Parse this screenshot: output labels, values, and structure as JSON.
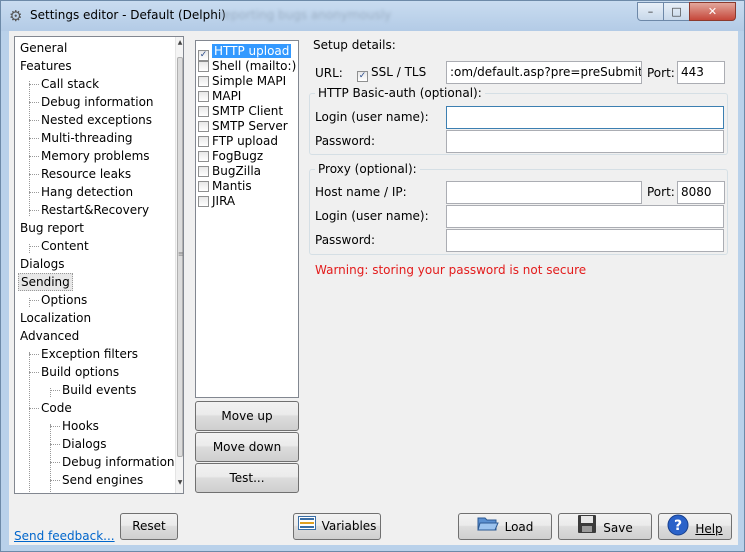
{
  "window": {
    "title": "Settings editor - Default (Delphi)",
    "title_ghost": "reporting bugs anonymously",
    "minimize": "–",
    "maximize": "□",
    "close": "✕"
  },
  "tree": {
    "items": [
      {
        "label": "General"
      },
      {
        "label": "Features"
      },
      {
        "label": "Call stack"
      },
      {
        "label": "Debug information"
      },
      {
        "label": "Nested exceptions"
      },
      {
        "label": "Multi-threading"
      },
      {
        "label": "Memory problems"
      },
      {
        "label": "Resource leaks"
      },
      {
        "label": "Hang detection"
      },
      {
        "label": "Restart&Recovery"
      },
      {
        "label": "Bug report"
      },
      {
        "label": "Content"
      },
      {
        "label": "Dialogs"
      },
      {
        "label": "Sending"
      },
      {
        "label": "Options"
      },
      {
        "label": "Localization"
      },
      {
        "label": "Advanced"
      },
      {
        "label": "Exception filters"
      },
      {
        "label": "Build options"
      },
      {
        "label": "Build events"
      },
      {
        "label": "Code"
      },
      {
        "label": "Hooks"
      },
      {
        "label": "Dialogs"
      },
      {
        "label": "Debug information"
      },
      {
        "label": "Send engines"
      }
    ],
    "selected": "Sending"
  },
  "send_methods": {
    "items": [
      {
        "label": "HTTP upload",
        "checked": true
      },
      {
        "label": "Shell (mailto:)",
        "checked": false
      },
      {
        "label": "Simple MAPI",
        "checked": false
      },
      {
        "label": "MAPI",
        "checked": false
      },
      {
        "label": "SMTP Client",
        "checked": false
      },
      {
        "label": "SMTP Server",
        "checked": false
      },
      {
        "label": "FTP upload",
        "checked": false
      },
      {
        "label": "FogBugz",
        "checked": false
      },
      {
        "label": "BugZilla",
        "checked": false
      },
      {
        "label": "Mantis",
        "checked": false
      },
      {
        "label": "JIRA",
        "checked": false
      }
    ],
    "selected": "HTTP upload",
    "move_up": "Move up",
    "move_down": "Move down",
    "test": "Test..."
  },
  "setup": {
    "title": "Setup details:",
    "url_label": "URL:",
    "ssl_label": "SSL / TLS",
    "ssl_checked": true,
    "url_value": ":om/default.asp?pre=preSubmitBug",
    "port_label": "Port:",
    "port_value": "443",
    "auth": {
      "title": "HTTP Basic-auth (optional):",
      "login_label": "Login (user name):",
      "login_value": "",
      "password_label": "Password:",
      "password_value": ""
    },
    "proxy": {
      "title": "Proxy (optional):",
      "host_label": "Host name / IP:",
      "host_value": "",
      "port_label": "Port:",
      "port_value": "8080",
      "login_label": "Login (user name):",
      "login_value": "",
      "password_label": "Password:",
      "password_value": ""
    },
    "warning": "Warning: storing your password is not secure",
    "warning_color": "#e31b1b"
  },
  "footer": {
    "feedback_link": "Send feedback...",
    "reset": "Reset",
    "variables": "Variables",
    "load": "Load",
    "save": "Save",
    "help": "Help"
  },
  "icons": {
    "title": "gear-icon",
    "variables": "list-icon",
    "load": "folder-open-icon",
    "save": "floppy-disk-icon",
    "help": "help-icon"
  }
}
